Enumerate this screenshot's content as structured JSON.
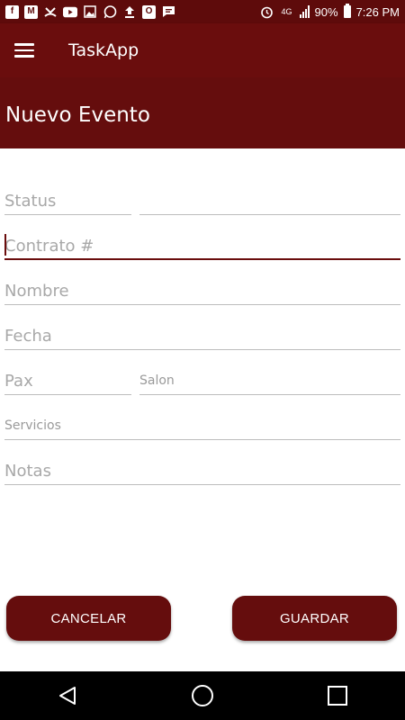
{
  "status_bar": {
    "battery": "90%",
    "time": "7:26 PM",
    "network": "4G",
    "left_icons": [
      "facebook-icon",
      "gmail-icon",
      "missed-call-icon",
      "youtube-icon",
      "gallery-icon",
      "whatsapp-icon",
      "upload-icon",
      "outlook-icon",
      "message-icon"
    ],
    "right_icons": [
      "alarm-icon",
      "lte-icon",
      "signal-icon",
      "battery-icon"
    ]
  },
  "app_bar": {
    "title": "TaskApp",
    "menu_icon": "hamburger-menu-icon"
  },
  "header": {
    "title": "Nuevo Evento"
  },
  "form": {
    "status": {
      "placeholder": "Status",
      "value": ""
    },
    "status_extra": {
      "placeholder": "",
      "value": ""
    },
    "contrato": {
      "placeholder": "Contrato #",
      "value": ""
    },
    "nombre": {
      "placeholder": "Nombre",
      "value": ""
    },
    "fecha": {
      "placeholder": "Fecha",
      "value": ""
    },
    "pax": {
      "placeholder": "Pax",
      "value": ""
    },
    "salon": {
      "placeholder": "Salon",
      "value": ""
    },
    "servicios": {
      "placeholder": "Servicios",
      "value": ""
    },
    "notas": {
      "placeholder": "Notas",
      "value": ""
    }
  },
  "buttons": {
    "cancel": "CANCELAR",
    "save": "GUARDAR"
  },
  "colors": {
    "primary": "#6a0d0d",
    "status_bar": "#5e0b0b",
    "underline": "#bdbdbd",
    "placeholder": "#a8a8a8"
  }
}
